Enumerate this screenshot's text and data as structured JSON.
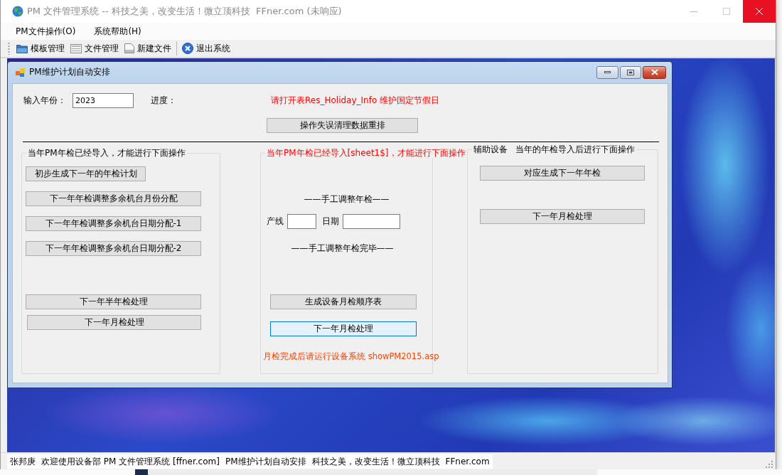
{
  "window": {
    "title": "PM 文件管理系统 -- 科技之美，改变生活！微立顶科技  FFner.com (未响应)"
  },
  "menu": [
    "PM文件操作(O)",
    "系统帮助(H)"
  ],
  "toolbar": [
    [
      "模板管理",
      "文件管理",
      "新建文件"
    ],
    [
      "退出系统"
    ]
  ],
  "child_window": {
    "title": "PM维护计划自动安排",
    "year_label": "输入年份：",
    "year_value": "2023",
    "progress_label": "进度：",
    "notice": "请打开表Res_Holiday_Info 维护国定节假日",
    "reset_button": "操作失误清理数据重排",
    "left_group": {
      "legend": "当年PM年检已经导入，才能进行下面操作",
      "buttons": [
        "初步生成下一年的年检计划",
        "下一年年检调整多余机台月份分配",
        "下一年年检调整多余机台日期分配-1",
        "下一年年检调整多余机台日期分配-2"
      ],
      "lower_buttons": [
        "下一年半年检处理",
        "下一年月检处理"
      ]
    },
    "middle_group": {
      "legend": "当年PM年检已经导入[sheet1$]，才能进行下面操作",
      "manual_start": "——手工调整年检——",
      "line_label": "产线",
      "date_label": "日期",
      "manual_end": "——手工调整年检完毕——",
      "buttons": [
        {
          "label": "生成设备月检顺序表",
          "focused": false
        },
        {
          "label": "下一年月检处理",
          "focused": true
        }
      ],
      "note": "月检完成后请运行设备系统 showPM2015.asp"
    },
    "right_group": {
      "legend": "辅助设备   当年的年检导入后进行下面操作",
      "buttons": [
        "对应生成下一年年检",
        "下一年月检处理"
      ]
    }
  },
  "status_bar": [
    "张邦庚",
    "欢迎使用设备部 PM 文件管理系统 [ffner.com]",
    "PM维护计划自动安排",
    "科技之美，改变生活！微立顶科技",
    "FFner.com"
  ]
}
